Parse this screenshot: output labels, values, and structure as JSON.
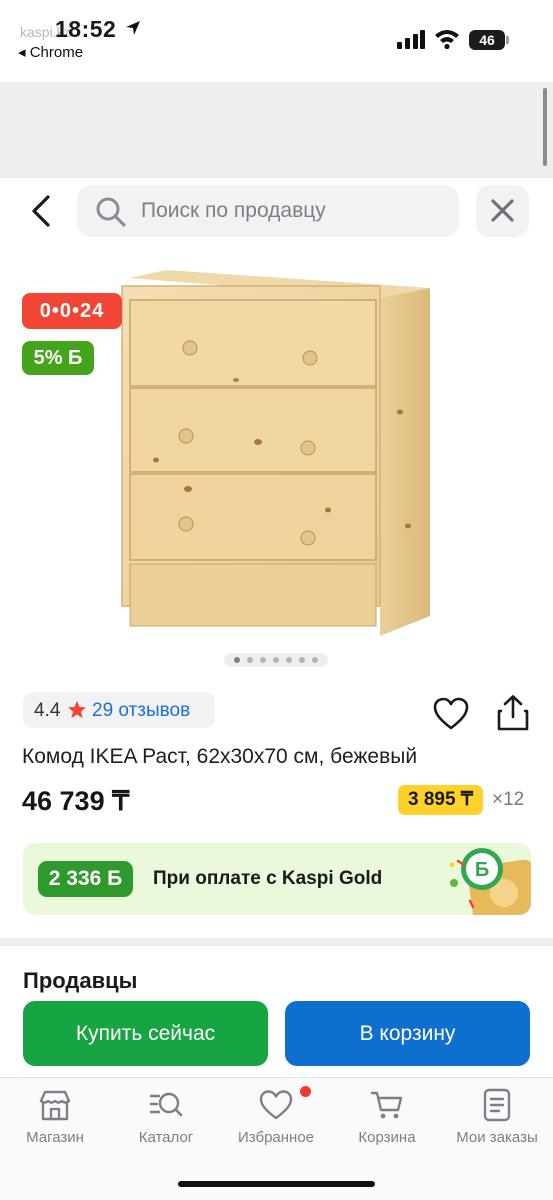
{
  "status_bar": {
    "time": "18:52",
    "back_app": "◂ Chrome",
    "ghost_text": "kaspi.kz",
    "battery": "46"
  },
  "search": {
    "placeholder": "Поиск по продавцу"
  },
  "product": {
    "badge_timer": "0•0•24",
    "badge_bonus": "5% Б",
    "rating": "4.4",
    "reviews": "29 отзывов",
    "title": "Комод IKEA Раст, 62x30x70 см, бежевый",
    "price": "46 739 ₸",
    "installment": "3 895 ₸",
    "installment_multiplier": "×12",
    "image_count": 7,
    "active_image": 1
  },
  "promo": {
    "bonus": "2 336 Б",
    "text": "При оплате с Kaspi Gold"
  },
  "sellers": {
    "title": "Продавцы"
  },
  "actions": {
    "buy": "Купить сейчас",
    "cart": "В корзину"
  },
  "tabbar": {
    "items": [
      {
        "label": "Магазин",
        "icon": "store-icon"
      },
      {
        "label": "Каталог",
        "icon": "catalog-search-icon"
      },
      {
        "label": "Избранное",
        "icon": "heart-icon"
      },
      {
        "label": "Корзина",
        "icon": "cart-icon"
      },
      {
        "label": "Мои заказы",
        "icon": "orders-icon"
      }
    ]
  },
  "colors": {
    "timer_badge": "#f14635",
    "bonus_badge": "#44a51d",
    "buy_button": "#17a544",
    "cart_button": "#0f6fcf",
    "installment": "#ffd12b",
    "reviews_link": "#1e6ed6"
  }
}
